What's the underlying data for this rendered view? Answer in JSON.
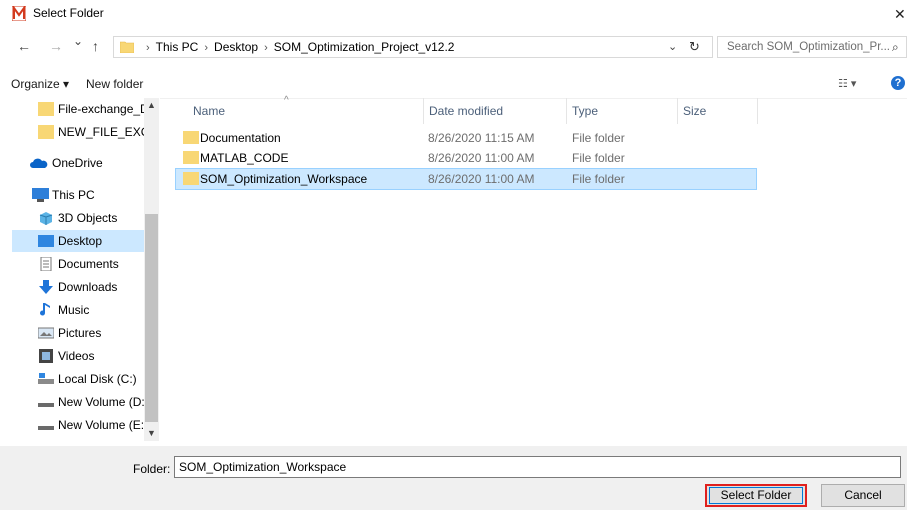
{
  "window": {
    "title": "Select Folder",
    "close": "✕"
  },
  "nav": {
    "back": "←",
    "forward": "→",
    "recent": "⌄",
    "up": "↑"
  },
  "address": {
    "crumbs": [
      "This PC",
      "Desktop",
      "SOM_Optimization_Project_v12.2"
    ],
    "separator": "›",
    "dropdown": "⌄",
    "refresh": "↻"
  },
  "search": {
    "placeholder": "Search SOM_Optimization_Pr...",
    "icon": "⌕"
  },
  "toolbar": {
    "organize": "Organize ▾",
    "new_folder": "New folder",
    "view": "☷ ▾",
    "help": "?"
  },
  "sidebar": {
    "items": [
      {
        "label": "File-exchange_D",
        "icon": "folder-icon"
      },
      {
        "label": "NEW_FILE_EXCH",
        "icon": "folder-icon"
      },
      {
        "label": "OneDrive",
        "icon": "cloud-icon"
      },
      {
        "label": "This PC",
        "icon": "computer-icon"
      },
      {
        "label": "3D Objects",
        "icon": "cube-icon"
      },
      {
        "label": "Desktop",
        "icon": "desktop-icon",
        "selected": true
      },
      {
        "label": "Documents",
        "icon": "document-icon"
      },
      {
        "label": "Downloads",
        "icon": "download-icon"
      },
      {
        "label": "Music",
        "icon": "music-icon"
      },
      {
        "label": "Pictures",
        "icon": "pictures-icon"
      },
      {
        "label": "Videos",
        "icon": "video-icon"
      },
      {
        "label": "Local Disk (C:)",
        "icon": "drive-icon"
      },
      {
        "label": "New Volume (D:",
        "icon": "drive-icon"
      },
      {
        "label": "New Volume (E:)",
        "icon": "drive-icon"
      }
    ]
  },
  "columns": {
    "name": "Name",
    "date": "Date modified",
    "type": "Type",
    "size": "Size",
    "sort_indicator": "^"
  },
  "files": [
    {
      "name": "Documentation",
      "date": "8/26/2020 11:15 AM",
      "type": "File folder"
    },
    {
      "name": "MATLAB_CODE",
      "date": "8/26/2020 11:00 AM",
      "type": "File folder"
    },
    {
      "name": "SOM_Optimization_Workspace",
      "date": "8/26/2020 11:00 AM",
      "type": "File folder",
      "selected": true
    }
  ],
  "footer": {
    "folder_label": "Folder:",
    "folder_value": "SOM_Optimization_Workspace",
    "select_button": "Select Folder",
    "cancel_button": "Cancel"
  },
  "colors": {
    "selection": "#cce8ff",
    "accent": "#0078d7",
    "highlight_border": "#e0201d",
    "folder": "#f8d775"
  }
}
